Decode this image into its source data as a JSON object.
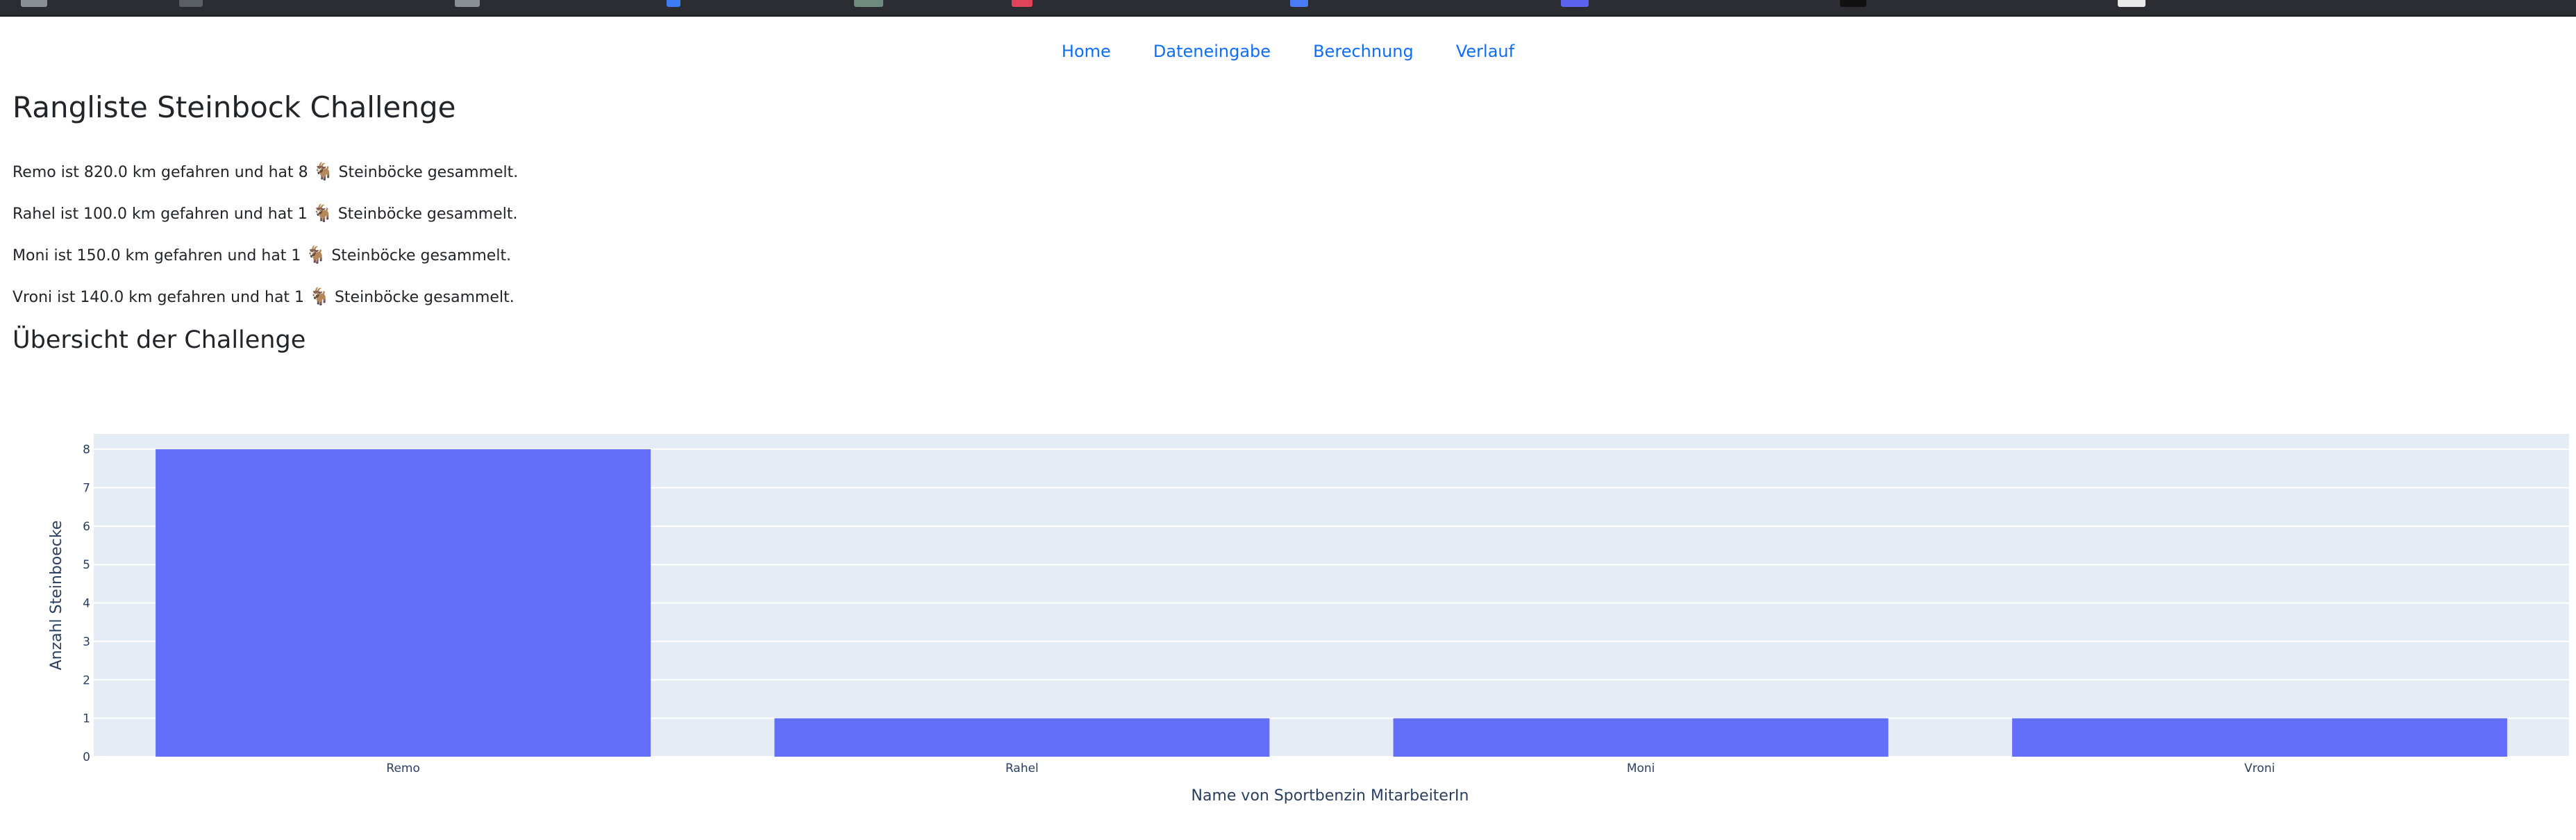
{
  "nav": {
    "items": [
      "Home",
      "Dateneingabe",
      "Berechnung",
      "Verlauf"
    ]
  },
  "page_title": "Rangliste Steinbock Challenge",
  "ranking": [
    {
      "before": "Remo ist 820.0 km gefahren und hat 8",
      "icon": "ibex-icon",
      "after": "Steinböcke gesammelt."
    },
    {
      "before": "Rahel ist 100.0 km gefahren und hat 1",
      "icon": "ibex-icon",
      "after": "Steinböcke gesammelt."
    },
    {
      "before": "Moni ist 150.0 km gefahren und hat 1",
      "icon": "ibex-icon",
      "after": "Steinböcke gesammelt."
    },
    {
      "before": "Vroni ist 140.0 km gefahren und hat 1",
      "icon": "ibex-icon",
      "after": "Steinböcke gesammelt."
    }
  ],
  "section_title": "Übersicht der Challenge",
  "colors": {
    "link": "#0d6efd",
    "bar": "#636efa",
    "plot_bg": "#e5ecf6",
    "axis_text": "#2a3f5f"
  },
  "chart_data": {
    "type": "bar",
    "categories": [
      "Remo",
      "Rahel",
      "Moni",
      "Vroni"
    ],
    "values": [
      8,
      1,
      1,
      1
    ],
    "title": "",
    "xlabel": "Name von Sportbenzin MitarbeiterIn",
    "ylabel": "Anzahl Steinboecke",
    "ylim": [
      0,
      8.4
    ],
    "yticks": [
      0,
      1,
      2,
      3,
      4,
      5,
      6,
      7,
      8
    ],
    "grid": true,
    "legend": "none"
  }
}
